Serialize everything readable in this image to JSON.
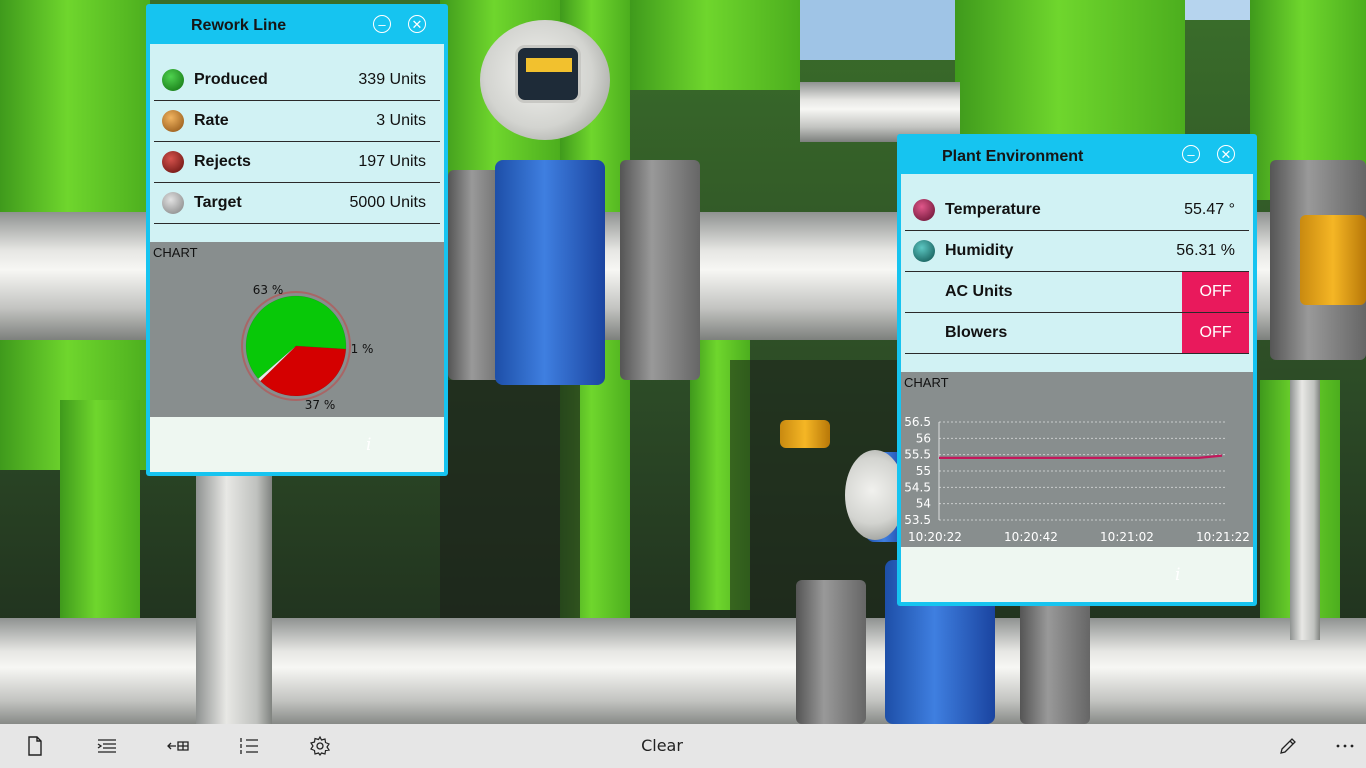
{
  "rework_line": {
    "title": "Rework Line",
    "metrics": [
      {
        "label": "Produced",
        "value": "339 Units",
        "color": "#1d8a1d"
      },
      {
        "label": "Rate",
        "value": "3 Units",
        "color": "#c98a2c"
      },
      {
        "label": "Rejects",
        "value": "197 Units",
        "color": "#a3231f"
      },
      {
        "label": "Target",
        "value": "5000 Units",
        "color": "#a9a9a9"
      }
    ],
    "chart_caption": "CHART",
    "chart_data": {
      "type": "pie",
      "slices": [
        {
          "label": "63 %",
          "value": 63,
          "color": "#08c808"
        },
        {
          "label": "37 %",
          "value": 37,
          "color": "#d40000"
        },
        {
          "label": "1 %",
          "value": 1,
          "color": "#e8e8e8"
        }
      ]
    }
  },
  "plant_environment": {
    "title": "Plant Environment",
    "metrics": [
      {
        "label": "Temperature",
        "value": "55.47 °",
        "color": "#a0204a"
      },
      {
        "label": "Humidity",
        "value": "56.31 %",
        "color": "#1f8a86"
      }
    ],
    "toggles": [
      {
        "label": "AC Units",
        "state": "OFF"
      },
      {
        "label": "Blowers",
        "state": "OFF"
      }
    ],
    "chart_caption": "CHART",
    "chart_data": {
      "type": "line",
      "x": [
        "10:20:22",
        "10:20:42",
        "10:21:02",
        "10:21:22"
      ],
      "y_ticks": [
        "56.5",
        "56",
        "55.5",
        "55",
        "54.5",
        "54",
        "53.5"
      ],
      "ylim": [
        53.5,
        56.5
      ],
      "series": [
        {
          "color": "#c2185b",
          "values": [
            55.4,
            55.4,
            55.4,
            55.4,
            55.4,
            55.4,
            55.4,
            55.4,
            55.4,
            55.4,
            55.4,
            55.4,
            55.47
          ]
        }
      ]
    }
  },
  "app_bar": {
    "clear_label": "Clear",
    "icons": [
      "new-file-icon",
      "indent-list-icon",
      "back-grid-icon",
      "numbered-list-icon",
      "settings-gear-icon",
      "pencil-icon",
      "more-icon"
    ]
  }
}
